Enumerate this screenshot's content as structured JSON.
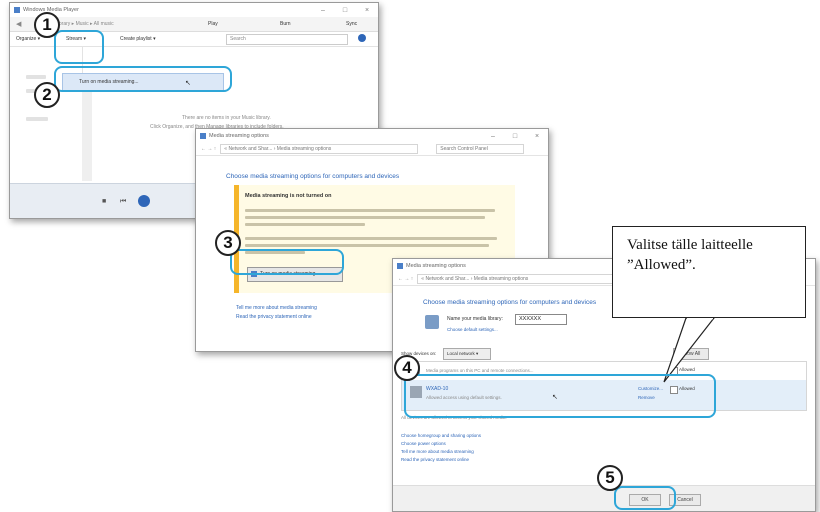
{
  "wmp": {
    "title": "Windows Media Player",
    "breadcrumb": "Library ▸ Music ▸ All music",
    "tabs": [
      "Play",
      "Burn",
      "Sync"
    ],
    "menu": {
      "organize": "Organize ▾",
      "stream": "Stream ▾",
      "create_playlist": "Create playlist ▾"
    },
    "search_placeholder": "Search",
    "dropdown_item": "Turn on media streaming...",
    "empty_line1": "There are no items in your Music library.",
    "empty_line2": "Click Organize, and then Manage libraries to include folders."
  },
  "dialog1": {
    "title": "Media streaming options",
    "address": "« Network and Shar... › Media streaming options",
    "search_placeholder": "Search Control Panel",
    "heading": "Choose media streaming options for computers and devices",
    "warning_title": "Media streaming is not turned on",
    "turn_on_button": "Turn on media streaming",
    "link1": "Tell me more about media streaming",
    "link2": "Read the privacy statement online"
  },
  "dialog2": {
    "title": "Media streaming options",
    "address": "« Network and Shar... › Media streaming options",
    "heading": "Choose media streaming options for computers and devices",
    "library_label": "Name your media library:",
    "library_name": "XXXXXX",
    "default_settings_link": "Choose default settings...",
    "show_devices_label": "Show devices on:",
    "show_devices_value": "Local network ▾",
    "allow_all": "Allow All",
    "device1_name": "Media programs on this PC and remote connections...",
    "device1_status": "Allowed",
    "device2_name": "WXAD-10",
    "device2_sub": "Allowed access using default settings.",
    "device2_customize": "Customize...",
    "device2_remove": "Remove",
    "device2_status": "Allowed",
    "footer_note": "All devices are allowed to access your shared media.",
    "links": [
      "Choose homegroup and sharing options",
      "Choose power options",
      "Tell me more about media streaming",
      "Read the privacy statement online"
    ],
    "ok": "OK",
    "cancel": "Cancel"
  },
  "tooltip": {
    "text": "Valitse tälle laitteelle ”Allowed”."
  },
  "steps": [
    "1",
    "2",
    "3",
    "4",
    "5"
  ],
  "colors": {
    "highlight": "#2ea6d8",
    "warning": "#f5b52a",
    "link": "#2e66b8"
  }
}
